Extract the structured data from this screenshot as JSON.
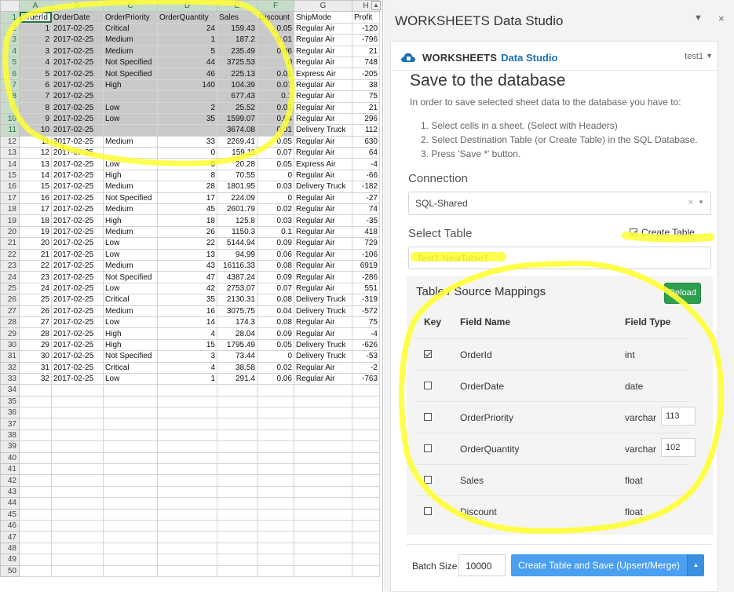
{
  "sheet": {
    "columns": [
      "A",
      "B",
      "C",
      "D",
      "E",
      "F",
      "G",
      "H"
    ],
    "headers": [
      "OrderId",
      "OrderDate",
      "OrderPriority",
      "OrderQuantity",
      "Sales",
      "Discount",
      "ShipMode",
      "Profit"
    ],
    "rows": [
      [
        "1",
        "2017-02-25",
        "Critical",
        "24",
        "159.43",
        "0.05",
        "Regular Air",
        "-120"
      ],
      [
        "2",
        "2017-02-25",
        "Medium",
        "1",
        "187.2",
        "0.01",
        "Regular Air",
        "-796"
      ],
      [
        "3",
        "2017-02-25",
        "Medium",
        "5",
        "235.49",
        "0.06",
        "Regular Air",
        "21"
      ],
      [
        "4",
        "2017-02-25",
        "Not Specified",
        "44",
        "3725.53",
        "0",
        "Regular Air",
        "748"
      ],
      [
        "5",
        "2017-02-25",
        "Not Specified",
        "46",
        "225.13",
        "0.01",
        "Express Air",
        "-205"
      ],
      [
        "6",
        "2017-02-25",
        "High",
        "140",
        "104.39",
        "0.07",
        "Regular Air",
        "38"
      ],
      [
        "7",
        "2017-02-25",
        "",
        "",
        "677.43",
        "0.1",
        "Regular Air",
        "75"
      ],
      [
        "8",
        "2017-02-25",
        "Low",
        "2",
        "25.52",
        "0.01",
        "Regular Air",
        "21"
      ],
      [
        "9",
        "2017-02-25",
        "Low",
        "35",
        "1599.07",
        "0.04",
        "Regular Air",
        "296"
      ],
      [
        "10",
        "2017-02-25",
        "",
        "",
        "3674.08",
        "0.01",
        "Delivery Truck",
        "112"
      ],
      [
        "11",
        "2017-02-25",
        "Medium",
        "33",
        "2269.41",
        "0.05",
        "Regular Air",
        "630"
      ],
      [
        "12",
        "2017-02-25",
        "",
        "0",
        "159.11",
        "0.07",
        "Regular Air",
        "64"
      ],
      [
        "13",
        "2017-02-25",
        "Low",
        "5",
        "20.28",
        "0.05",
        "Express Air",
        "-4"
      ],
      [
        "14",
        "2017-02-25",
        "High",
        "8",
        "70.55",
        "0",
        "Regular Air",
        "-66"
      ],
      [
        "15",
        "2017-02-25",
        "Medium",
        "28",
        "1801.95",
        "0.03",
        "Delivery Truck",
        "-182"
      ],
      [
        "16",
        "2017-02-25",
        "Not Specified",
        "17",
        "224.09",
        "0",
        "Regular Air",
        "-27"
      ],
      [
        "17",
        "2017-02-25",
        "Medium",
        "45",
        "2601.79",
        "0.02",
        "Regular Air",
        "74"
      ],
      [
        "18",
        "2017-02-25",
        "High",
        "18",
        "125.8",
        "0.03",
        "Regular Air",
        "-35"
      ],
      [
        "19",
        "2017-02-25",
        "Medium",
        "26",
        "1150.3",
        "0.1",
        "Regular Air",
        "418"
      ],
      [
        "20",
        "2017-02-25",
        "Low",
        "22",
        "5144.94",
        "0.09",
        "Regular Air",
        "729"
      ],
      [
        "21",
        "2017-02-25",
        "Low",
        "13",
        "94.99",
        "0.06",
        "Regular Air",
        "-106"
      ],
      [
        "22",
        "2017-02-25",
        "Medium",
        "43",
        "16116.33",
        "0.08",
        "Regular Air",
        "6919"
      ],
      [
        "23",
        "2017-02-25",
        "Not Specified",
        "47",
        "4387.24",
        "0.09",
        "Regular Air",
        "-286"
      ],
      [
        "24",
        "2017-02-25",
        "Low",
        "42",
        "2753.07",
        "0.07",
        "Regular Air",
        "551"
      ],
      [
        "25",
        "2017-02-25",
        "Critical",
        "35",
        "2130.31",
        "0.08",
        "Delivery Truck",
        "-319"
      ],
      [
        "26",
        "2017-02-25",
        "Medium",
        "16",
        "3075.75",
        "0.04",
        "Delivery Truck",
        "-572"
      ],
      [
        "27",
        "2017-02-25",
        "Low",
        "14",
        "174.3",
        "0.08",
        "Regular Air",
        "75"
      ],
      [
        "28",
        "2017-02-25",
        "High",
        "4",
        "28.04",
        "0.09",
        "Regular Air",
        "-4"
      ],
      [
        "29",
        "2017-02-25",
        "High",
        "15",
        "1795.49",
        "0.05",
        "Delivery Truck",
        "-626"
      ],
      [
        "30",
        "2017-02-25",
        "Not Specified",
        "3",
        "73.44",
        "0",
        "Delivery Truck",
        "-53"
      ],
      [
        "31",
        "2017-02-25",
        "Critical",
        "4",
        "38.58",
        "0.02",
        "Regular Air",
        "-2"
      ],
      [
        "32",
        "2017-02-25",
        "Low",
        "1",
        "291.4",
        "0.06",
        "Regular Air",
        "-763"
      ]
    ],
    "total_rows": 50,
    "selected_rows": 10,
    "selected_cols": 6
  },
  "pane": {
    "title": "WORKSHEETS Data Studio",
    "brand_ws": "WORKSHEETS",
    "brand_ds": "Data Studio",
    "user": "test1",
    "heading": "Save to the database",
    "intro": "In order to save selected sheet data to the database you have to:",
    "steps": [
      "1. Select cells in a sheet. (Select with Headers)",
      "2. Select Destination Table (or Create Table) in the SQL Database.",
      "3. Press 'Save *' button."
    ],
    "connection_label": "Connection",
    "connection_value": "SQL-Shared",
    "clear_symbol": "×",
    "select_table_label": "Select Table",
    "create_table_label": "Create Table",
    "create_table_checked": true,
    "table_value": "Test1.NewTable1",
    "mapping": {
      "title": "Table / Source Mappings",
      "reload": "Reload",
      "col_key": "Key",
      "col_field": "Field Name",
      "col_type": "Field Type",
      "rows": [
        {
          "key": true,
          "name": "OrderId",
          "type": "int",
          "len": ""
        },
        {
          "key": false,
          "name": "OrderDate",
          "type": "date",
          "len": ""
        },
        {
          "key": false,
          "name": "OrderPriority",
          "type": "varchar",
          "len": "113"
        },
        {
          "key": false,
          "name": "OrderQuantity",
          "type": "varchar",
          "len": "102"
        },
        {
          "key": false,
          "name": "Sales",
          "type": "float",
          "len": ""
        },
        {
          "key": false,
          "name": "Discount",
          "type": "float",
          "len": ""
        }
      ]
    },
    "batch_label": "Batch Size",
    "batch_value": "10000",
    "save_button": "Create Table and Save (Upsert/Merge)"
  },
  "colors": {
    "accent_blue": "#4a9ff0",
    "reload_green": "#2e9e4f",
    "brand_blue": "#1a6fb5",
    "excel_green": "#217346",
    "highlighter": "#ffff33"
  }
}
